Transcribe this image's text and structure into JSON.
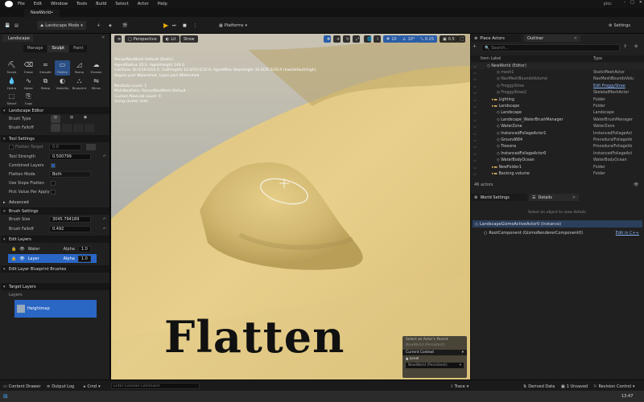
{
  "menubar": {
    "items": [
      "File",
      "Edit",
      "Window",
      "Tools",
      "Build",
      "Select",
      "Actor",
      "Help"
    ],
    "project": "ploc"
  },
  "tab": {
    "title": "NewWorld•"
  },
  "toolbar": {
    "mode": "Landscape Mode",
    "platforms": "Platforms",
    "settings": "Settings"
  },
  "left": {
    "panel_title": "Landscape",
    "modes": [
      "Manage",
      "Sculpt",
      "Paint"
    ],
    "tools": [
      "Sculpt",
      "Erase",
      "Smooth",
      "Flatten",
      "Ramp",
      "Erosion",
      "Hydro",
      "Noise",
      "Retop",
      "Visibility",
      "Blueprint",
      "Mirror",
      "Select",
      "Copy"
    ],
    "sections": {
      "editor": "Landscape Editor",
      "tool_settings": "Tool Settings",
      "advanced": "Advanced",
      "brush_settings": "Brush Settings",
      "edit_layers": "Edit Layers",
      "edit_layer_bp": "Edit Layer Blueprint Brushes",
      "target_layers": "Target Layers"
    },
    "rows": {
      "brush_type": "Brush Type",
      "brush_falloff": "Brush Falloff",
      "flatten_target": "Flatten Target",
      "flatten_target_val": "0.0",
      "tool_strength": "Tool Strength",
      "tool_strength_val": "0.500799",
      "combined_layers": "Combined Layers",
      "flatten_mode": "Flatten Mode",
      "flatten_mode_val": "Both",
      "use_slope": "Use Slope Flatten",
      "pick_value": "Pick Value Per Apply",
      "brush_size": "Brush Size",
      "brush_size_val": "3045.794189",
      "brush_falloff2": "Brush Falloff",
      "brush_falloff2_val": "0.492"
    },
    "edit_layers": [
      {
        "name": "Water",
        "alpha_label": "Alpha",
        "alpha": "1.0"
      },
      {
        "name": "Layer",
        "alpha_label": "Alpha",
        "alpha": "1.0"
      }
    ],
    "target_layers": {
      "label": "Layers",
      "item": "Heightmap"
    }
  },
  "viewport": {
    "perspective": "Perspective",
    "lit": "Lit",
    "show": "Show",
    "snap1": "10",
    "snap2": "10°",
    "snap3": "0.25",
    "cam": "0.5",
    "debug": "RecastNavMesh-Default (Static)\nAgentRadius 35.0, AgentHeight 144.0\nCellSizes 30.0/19.0/10.0, CellHeights 10.0/10.0/10.0, AgentMax StepHeight 35.0/35.0/35.0 (low/default/high)\nRegion part Watershed, Layer part Watershed\n\nNavData count: 1\nMainNavData: RecastNavMesh-Default\nCustom NavLink count: 0\nUsing cluster links",
    "overlay_text": "Flatten",
    "level_panel": {
      "line1": "Select an Actor’s Parent",
      "line2": "NewWorld (Persistent)",
      "context": "Current Context",
      "level": "Level",
      "level_val": "NewWorld (Persistent)"
    }
  },
  "right": {
    "tabs": [
      "Place Actors",
      "Outliner"
    ],
    "search_placeholder": "Search...",
    "col_item": "Item Label",
    "col_type": "Type",
    "rows": [
      {
        "label": "NewWorld (Editor)",
        "type": ""
      },
      {
        "label": "mesh1",
        "type": "StaticMeshActor"
      },
      {
        "label": "NavMeshBoundsVolume",
        "type": "NavMeshBoundsVolu"
      },
      {
        "label": "FroggyStree",
        "type": "Edit FroggyStree"
      },
      {
        "label": "FroggyStree2",
        "type": "SkeletalMeshActor"
      },
      {
        "label": "Lighting",
        "type": "Folder"
      },
      {
        "label": "Landscape",
        "type": "Folder"
      },
      {
        "label": "Landscape",
        "type": "Landscape"
      },
      {
        "label": "Landscape_WaterBrushManager",
        "type": "WaterBrushManager"
      },
      {
        "label": "WaterZone",
        "type": "WaterZone"
      },
      {
        "label": "InstancedFoliageActor1",
        "type": "InstancedFoliageAct"
      },
      {
        "label": "Ground684",
        "type": "ProceduralFoliageVo"
      },
      {
        "label": "Treeone",
        "type": "ProceduralFoliageVo"
      },
      {
        "label": "InstancedFoliageActor0",
        "type": "InstancedFoliageAct"
      },
      {
        "label": "WaterBodyOcean",
        "type": "WaterBodyOcean"
      },
      {
        "label": "NewFolder1",
        "type": "Folder"
      },
      {
        "label": "Backing volume",
        "type": "Folder"
      }
    ],
    "actor_count": "46 actors",
    "details_tabs": [
      "World Settings",
      "Details"
    ],
    "details_hint": "Select an object to view details.",
    "component_root": "LandscapeGizmoActiveActor0 (Instance)",
    "component_child": "RootComponent (GizmoRendererComponent0)",
    "edit_cpp": "Edit in C++"
  },
  "status": {
    "content_drawer": "Content Drawer",
    "output_log": "Output Log",
    "cmd": "Cmd",
    "console_placeholder": "Enter Console Command",
    "trace": "Trace",
    "derived": "Derived Data",
    "unsaved": "1 Unsaved",
    "revision": "Revision Control"
  },
  "taskbar": {
    "time": "13:47"
  }
}
